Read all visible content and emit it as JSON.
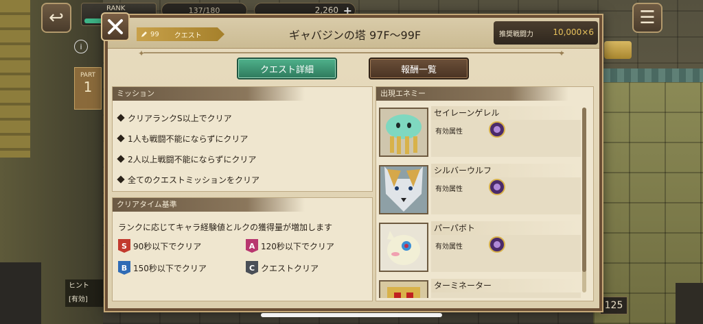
{
  "hud": {
    "rank_label": "RANK",
    "stamina": "137/180",
    "gems": "2,260",
    "gems_plus": "+",
    "back_icon": "back-arrow-icon",
    "menu_icon": "hamburger-menu-icon"
  },
  "background": {
    "part_label": "PART",
    "part_number": "1",
    "info": "i",
    "hint_label": "ヒント",
    "hint_sub": "[有効]",
    "right_count": "125"
  },
  "modal": {
    "quest_level": "99",
    "quest_type": "クエスト",
    "title": "ギャバジンの塔 97F〜99F",
    "power_label": "推奨戦闘力",
    "power_value": "10,000×6",
    "tabs": [
      {
        "label": "クエスト詳細",
        "active": true
      },
      {
        "label": "報酬一覧",
        "active": false
      }
    ]
  },
  "mission": {
    "header": "ミッション",
    "items": [
      "クリアランクS以上でクリア",
      "1人も戦闘不能にならずにクリア",
      "2人以上戦闘不能にならずにクリア",
      "全てのクエストミッションをクリア"
    ]
  },
  "clear_time": {
    "header": "クリアタイム基準",
    "description": "ランクに応じてキャラ経験値とルクの獲得量が増加します",
    "ranks": [
      {
        "badge": "S",
        "text": "90秒以下でクリア",
        "color": "#c23a2e"
      },
      {
        "badge": "A",
        "text": "120秒以下でクリア",
        "color": "#b8366f"
      },
      {
        "badge": "B",
        "text": "150秒以下でクリア",
        "color": "#2f6bb5"
      },
      {
        "badge": "C",
        "text": "クエストクリア",
        "color": "#4a4f57"
      }
    ]
  },
  "enemies": {
    "header": "出現エネミー",
    "attr_label": "有効属性",
    "list": [
      {
        "name": "セイレーンゲレル",
        "portrait": "jellyfish-portrait",
        "attr_icon": "dark-attribute-icon"
      },
      {
        "name": "シルバーウルフ",
        "portrait": "wolf-portrait",
        "attr_icon": "dark-attribute-icon"
      },
      {
        "name": "パーパボト",
        "portrait": "dragon-portrait",
        "attr_icon": "dark-attribute-icon"
      },
      {
        "name": "ターミネーター",
        "portrait": "robot-portrait",
        "attr_icon": "dark-attribute-icon"
      }
    ]
  }
}
